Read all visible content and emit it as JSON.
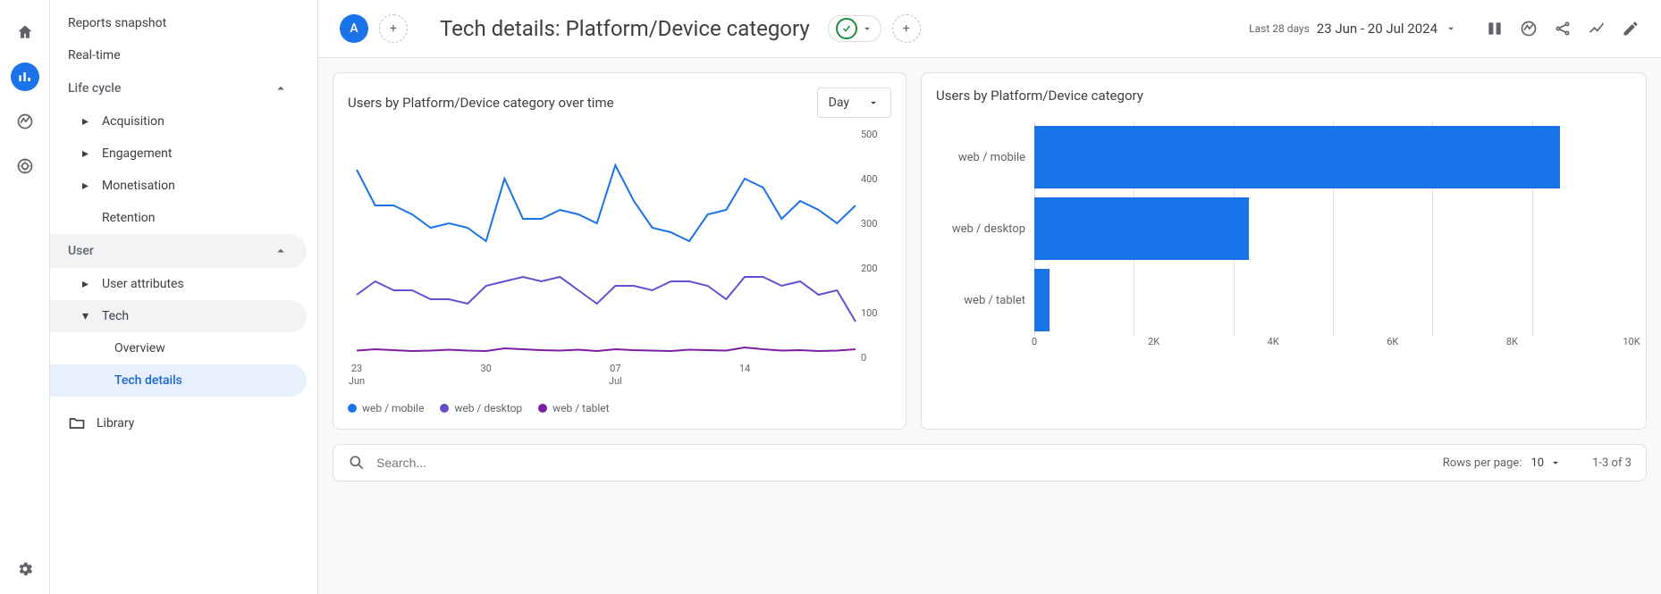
{
  "rail": {
    "avatar_initial": "A"
  },
  "sidebar": {
    "reports_snapshot": "Reports snapshot",
    "realtime": "Real-time",
    "life_cycle": "Life cycle",
    "acquisition": "Acquisition",
    "engagement": "Engagement",
    "monetisation": "Monetisation",
    "retention": "Retention",
    "user": "User",
    "user_attributes": "User attributes",
    "tech": "Tech",
    "overview": "Overview",
    "tech_details": "Tech details",
    "library": "Library"
  },
  "header": {
    "avatar_letter": "A",
    "title": "Tech details: Platform/Device category",
    "date_label": "Last 28 days",
    "date_value": "23 Jun - 20 Jul 2024"
  },
  "line_card": {
    "title": "Users by Platform/Device category over time",
    "granularity": "Day"
  },
  "bar_card": {
    "title": "Users by Platform/Device category"
  },
  "search": {
    "placeholder": "Search...",
    "rpp_label": "Rows per page:",
    "rpp_value": "10",
    "range": "1-3 of 3"
  },
  "colors": {
    "mobile": "#1a73e8",
    "desktop": "#6a4cd1",
    "tablet": "#7b1fa2"
  },
  "chart_data": [
    {
      "type": "line",
      "title": "Users by Platform/Device category over time",
      "xlabel": "",
      "ylabel": "",
      "ylim": [
        0,
        500
      ],
      "x": [
        "23 Jun",
        "24",
        "25",
        "26",
        "27",
        "28",
        "29",
        "30",
        "01 Jul",
        "02",
        "03",
        "04",
        "05",
        "06",
        "07",
        "08",
        "09",
        "10",
        "11",
        "12",
        "13",
        "14",
        "15",
        "16",
        "17",
        "18",
        "19",
        "20"
      ],
      "x_ticks": [
        {
          "label_top": "23",
          "label_bottom": "Jun",
          "index": 0
        },
        {
          "label_top": "30",
          "label_bottom": "",
          "index": 7
        },
        {
          "label_top": "07",
          "label_bottom": "Jul",
          "index": 14
        },
        {
          "label_top": "14",
          "label_bottom": "",
          "index": 21
        }
      ],
      "series": [
        {
          "name": "web / mobile",
          "color": "#1a73e8",
          "values": [
            420,
            340,
            340,
            320,
            290,
            300,
            290,
            260,
            400,
            310,
            310,
            330,
            320,
            300,
            430,
            350,
            290,
            280,
            260,
            320,
            330,
            400,
            380,
            310,
            350,
            330,
            300,
            340
          ]
        },
        {
          "name": "web / desktop",
          "color": "#6a4cd1",
          "values": [
            140,
            170,
            150,
            150,
            130,
            130,
            120,
            160,
            170,
            180,
            170,
            180,
            150,
            120,
            160,
            160,
            150,
            170,
            170,
            160,
            130,
            180,
            180,
            160,
            170,
            140,
            150,
            80
          ]
        },
        {
          "name": "web / tablet",
          "color": "#7b1fa2",
          "values": [
            15,
            18,
            16,
            14,
            15,
            17,
            15,
            14,
            20,
            18,
            16,
            15,
            17,
            14,
            18,
            16,
            15,
            14,
            17,
            16,
            15,
            22,
            18,
            15,
            16,
            14,
            15,
            18
          ]
        }
      ]
    },
    {
      "type": "bar",
      "title": "Users by Platform/Device category",
      "xlim": [
        0,
        10000
      ],
      "x_ticks": [
        0,
        2000,
        4000,
        6000,
        8000,
        10000
      ],
      "x_tick_labels": [
        "0",
        "2K",
        "4K",
        "6K",
        "8K",
        "10K"
      ],
      "categories": [
        "web / mobile",
        "web / desktop",
        "web / tablet"
      ],
      "values": [
        8800,
        3600,
        250
      ]
    }
  ]
}
